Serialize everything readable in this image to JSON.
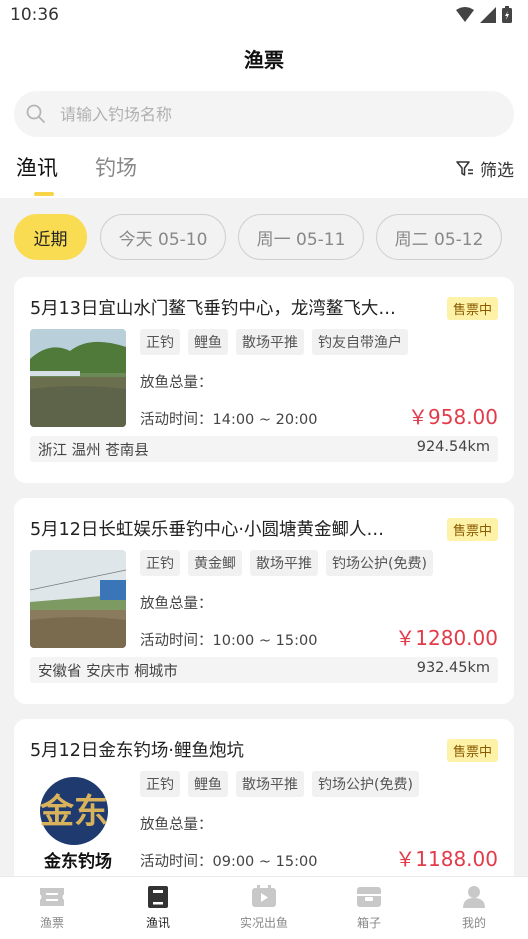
{
  "status": {
    "time": "10:36"
  },
  "header": {
    "title": "渔票"
  },
  "search": {
    "placeholder": "请输入钓场名称"
  },
  "tabs": [
    {
      "label": "渔讯"
    },
    {
      "label": "钓场"
    }
  ],
  "filter": {
    "label": "筛选"
  },
  "dates": [
    {
      "label": "近期"
    },
    {
      "label": "今天 05-10"
    },
    {
      "label": "周一 05-11"
    },
    {
      "label": "周二 05-12"
    }
  ],
  "cards": [
    {
      "title": "5月13日宜山水门鳌飞垂钓中心，龙湾鳌飞大…",
      "badge": "售票中",
      "tags": [
        "正钓",
        "鲤鱼",
        "散场平推",
        "钓友自带渔户"
      ],
      "fish_total": "放鱼总量：",
      "time": "活动时间：14:00 ~ 20:00",
      "price": "￥958.00",
      "location": "浙江 温州 苍南县",
      "distance": "924.54km"
    },
    {
      "title": "5月12日长虹娱乐垂钓中心·小圆塘黄金鲫人…",
      "badge": "售票中",
      "tags": [
        "正钓",
        "黄金鲫",
        "散场平推",
        "钓场公护(免费)"
      ],
      "fish_total": "放鱼总量：",
      "time": "活动时间：10:00 ~ 15:00",
      "price": "￥1280.00",
      "location": "安徽省 安庆市 桐城市",
      "distance": "932.45km"
    },
    {
      "title": "5月12日金东钓场·鲤鱼炮坑",
      "badge": "售票中",
      "tags": [
        "正钓",
        "鲤鱼",
        "散场平推",
        "钓场公护(免费)"
      ],
      "fish_total": "放鱼总量：",
      "time": "活动时间：09:00 ~ 15:00",
      "price": "￥1188.00",
      "logo_text": "金东钓场"
    }
  ],
  "bottom_nav": [
    {
      "label": "渔票"
    },
    {
      "label": "渔讯"
    },
    {
      "label": "实况出鱼"
    },
    {
      "label": "箱子"
    },
    {
      "label": "我的"
    }
  ],
  "colors": {
    "accent": "#f9dc52",
    "price": "#e23b4a",
    "badge_bg": "#fdf2a7"
  }
}
